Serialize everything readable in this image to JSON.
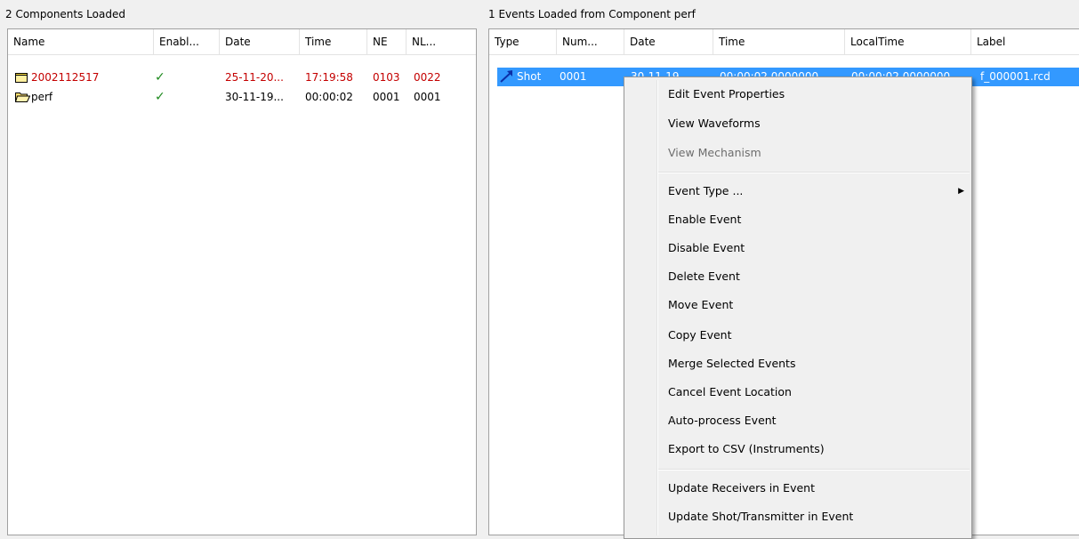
{
  "left_caption": "2 Components Loaded",
  "right_caption": "1 Events Loaded from Component perf",
  "components": {
    "columns": [
      "Name",
      "Enabl...",
      "Date",
      "Time",
      "NE",
      "NL..."
    ],
    "rows": [
      {
        "name": "2002112517",
        "enabled": "✓",
        "date": "25-11-20...",
        "time": "17:19:58",
        "ne": "0103",
        "nl": "0022",
        "icon": "closed-folder-icon",
        "color": "#c40000"
      },
      {
        "name": "perf",
        "enabled": "✓",
        "date": "30-11-19...",
        "time": "00:00:02",
        "ne": "0001",
        "nl": "0001",
        "icon": "open-folder-icon",
        "color": "#000000"
      }
    ]
  },
  "events": {
    "columns": [
      "Type",
      "Num...",
      "Date",
      "Time",
      "LocalTime",
      "Label"
    ],
    "rows": [
      {
        "type": "Shot",
        "num": "0001",
        "date": "30-11-19...",
        "time": "00:00:02.0000000",
        "localtime": "00:00:02.0000000",
        "label": "f_000001.rcd",
        "icon": "shot-arrow-icon",
        "selected": true
      }
    ]
  },
  "context_menu": {
    "edit_event_properties": "Edit Event Properties",
    "view_waveforms": "View Waveforms",
    "view_mechanism": "View Mechanism",
    "event_type": "Event Type ...",
    "submenu_arrow": "▶",
    "enable_event": "Enable Event",
    "disable_event": "Disable Event",
    "delete_event": "Delete Event",
    "move_event": "Move Event",
    "copy_event": "Copy Event",
    "merge_selected_events": "Merge Selected Events",
    "cancel_event_location": "Cancel Event Location",
    "auto_process_event": "Auto-process Event",
    "export_csv": "Export to CSV (Instruments)",
    "update_receivers": "Update Receivers in Event",
    "update_shot_transmitter": "Update Shot/Transmitter in Event"
  },
  "colors": {
    "selection": "#3399ff",
    "check": "#1e8a1e",
    "highlight_text": "#c40000"
  }
}
